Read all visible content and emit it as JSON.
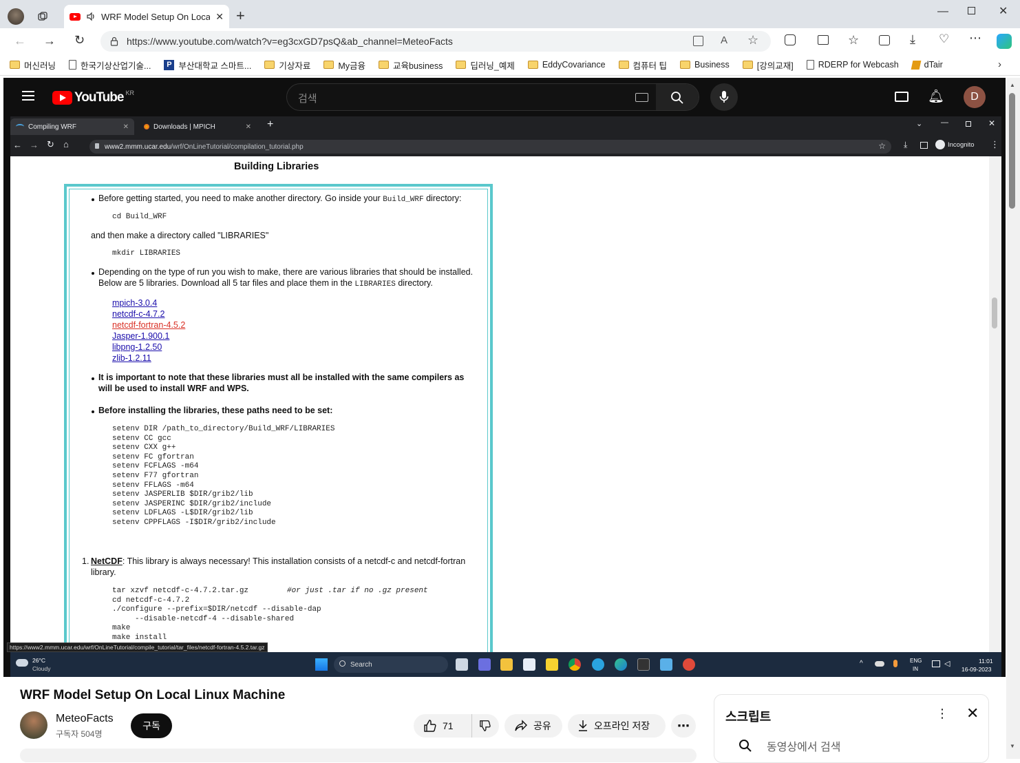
{
  "edge": {
    "tab_title": "WRF Model Setup On Local",
    "url": "https://www.youtube.com/watch?v=eg3cxGD7psQ&ab_channel=MeteoFacts"
  },
  "favorites": [
    {
      "label": "머신러닝",
      "type": "folder"
    },
    {
      "label": "한국기상산업기술...",
      "type": "page"
    },
    {
      "label": "부산대학교 스마트...",
      "type": "P"
    },
    {
      "label": "기상자료",
      "type": "folder"
    },
    {
      "label": "My금융",
      "type": "folder"
    },
    {
      "label": "교육business",
      "type": "folder"
    },
    {
      "label": "딥러닝_예제",
      "type": "folder"
    },
    {
      "label": "EddyCovariance",
      "type": "folder"
    },
    {
      "label": "컴퓨터 팁",
      "type": "folder"
    },
    {
      "label": "Business",
      "type": "folder"
    },
    {
      "label": "[강의교재]",
      "type": "folder"
    },
    {
      "label": "RDERP for Webcash",
      "type": "page"
    },
    {
      "label": "dTair",
      "type": "dtair"
    }
  ],
  "youtube": {
    "logo_text": "YouTube",
    "region": "KR",
    "search_placeholder": "검색",
    "avatar_letter": "D"
  },
  "chrome": {
    "tab1": "Compiling WRF",
    "tab2": "Downloads | MPICH",
    "url_host": "www2.mmm.ucar.edu",
    "url_path": "/wrf/OnLineTutorial/compilation_tutorial.php",
    "incognito": "Incognito"
  },
  "tutorial": {
    "heading": "Building Libraries",
    "p1": "Before getting started, you need to make another directory. Go inside your ",
    "p1_code": "Build_WRF",
    "p1_end": " directory:",
    "code1": "cd Build_WRF",
    "p2": "and then make a directory called \"LIBRARIES\"",
    "code2": "mkdir LIBRARIES",
    "p3a": "Depending on the type of run you wish to make, there are various libraries that should be installed.",
    "p3b": "Below are 5 libraries. Download all 5 tar files and place them in the ",
    "p3b_code": "LIBRARIES",
    "p3b_end": " directory.",
    "links": [
      "mpich-3.0.4",
      "netcdf-c-4.7.2",
      "netcdf-fortran-4.5.2",
      "Jasper-1.900.1",
      "libpng-1.2.50",
      "zlib-1.2.11"
    ],
    "b1a": "It is important to note that these libraries must all be installed with the same compilers as",
    "b1b": "will be used to install WRF and WPS.",
    "b2": "Before installing the libraries, these paths need to be set:",
    "env_block": "setenv DIR /path_to_directory/Build_WRF/LIBRARIES\nsetenv CC gcc\nsetenv CXX g++\nsetenv FC gfortran\nsetenv FCFLAGS -m64\nsetenv F77 gfortran\nsetenv FFLAGS -m64\nsetenv JASPERLIB $DIR/grib2/lib\nsetenv JASPERINC $DIR/grib2/include\nsetenv LDFLAGS -L$DIR/grib2/lib\nsetenv CPPFLAGS -I$DIR/grib2/include",
    "n1_num": "1.",
    "n1_title": "NetCDF",
    "n1_text": ": This library is always necessary! This installation consists of a netcdf-c and netcdf-fortran",
    "n1_text2": "library.",
    "netcdf_block": "tar xzvf netcdf-c-4.7.2.tar.gz\ncd netcdf-c-4.7.2\n./configure --prefix=$DIR/netcdf --disable-dap\n     --disable-netcdf-4 --disable-shared\nmake\nmake install",
    "netcdf_comment": "#or just .tar if no .gz present"
  },
  "status_url": "https://www2.mmm.ucar.edu/wrf/OnLineTutorial/compile_tutorial/tar_files/netcdf-fortran-4.5.2.tar.gz",
  "taskbar": {
    "temp": "26°C",
    "weather": "Cloudy",
    "search": "Search",
    "lang1": "ENG",
    "lang2": "IN",
    "time": "11:01",
    "date": "16-09-2023"
  },
  "video": {
    "title": "WRF Model Setup On Local Linux Machine",
    "channel": "MeteoFacts",
    "subscribers": "구독자 504명",
    "subscribe": "구독",
    "likes": "71",
    "share": "공유",
    "download": "오프라인 저장"
  },
  "transcript": {
    "title": "스크립트",
    "search_placeholder": "동영상에서 검색"
  }
}
